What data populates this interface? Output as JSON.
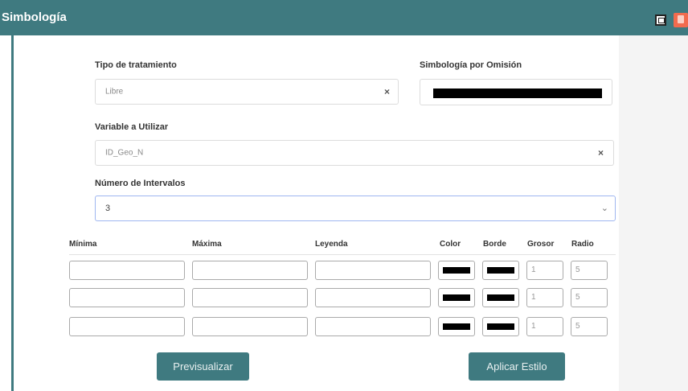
{
  "window": {
    "title": "Simbología"
  },
  "form": {
    "tipo_label": "Tipo de tratamiento",
    "tipo_value": "Libre",
    "omision_label": "Simbología por Omisión",
    "variable_label": "Variable a Utilizar",
    "variable_value": "ID_Geo_N",
    "intervalos_label": "Número de Intervalos",
    "intervalos_value": "3"
  },
  "table": {
    "headers": [
      "Mínima",
      "Máxima",
      "Leyenda",
      "Color",
      "Borde",
      "Grosor",
      "Radio"
    ],
    "rows": [
      {
        "minima": "",
        "maxima": "",
        "leyenda": "",
        "color": "#000000",
        "borde": "#000000",
        "grosor": "1",
        "radio": "5"
      },
      {
        "minima": "",
        "maxima": "",
        "leyenda": "",
        "color": "#000000",
        "borde": "#000000",
        "grosor": "1",
        "radio": "5"
      },
      {
        "minima": "",
        "maxima": "",
        "leyenda": "",
        "color": "#000000",
        "borde": "#000000",
        "grosor": "1",
        "radio": "5"
      }
    ]
  },
  "buttons": {
    "preview": "Previsualizar",
    "apply": "Aplicar Estilo"
  },
  "icons": {
    "clear": "×",
    "dropdown": "⌄"
  },
  "colors": {
    "accent": "#3f7a80",
    "close": "#f26b4e",
    "default_symbol": "#000000"
  }
}
